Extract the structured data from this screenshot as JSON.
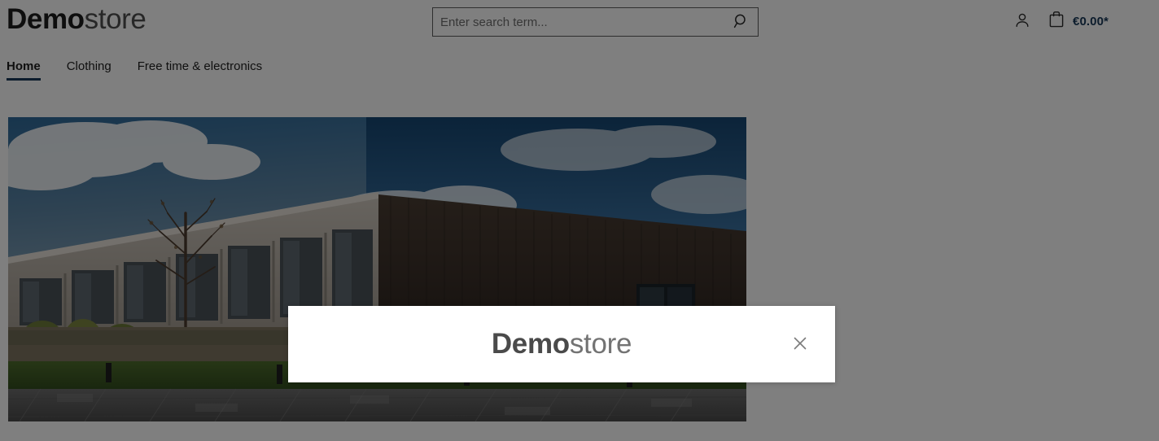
{
  "header": {
    "logo": {
      "bold": "Demo",
      "light": "store"
    },
    "search": {
      "placeholder": "Enter search term...",
      "value": "",
      "icon": "search-icon"
    },
    "account": {
      "icon": "person-icon",
      "label": ""
    },
    "cart": {
      "icon": "shopping-bag-icon",
      "amount": "€0.00*"
    }
  },
  "nav": {
    "items": [
      {
        "label": "Home",
        "active": true
      },
      {
        "label": "Clothing",
        "active": false
      },
      {
        "label": "Free time & electronics",
        "active": false
      }
    ]
  },
  "hero": {
    "alt": "Modern dark-wood and concrete office building under blue sky with clouds"
  },
  "modal": {
    "logo": {
      "bold": "Demo",
      "light": "store"
    },
    "close_icon": "close-icon",
    "close_label": "×"
  },
  "colors": {
    "accent": "#183959",
    "logo_bold": "#1d1d1d",
    "logo_light": "#4f4f4f",
    "modal_logo_bold": "#4a4a4a",
    "modal_logo_light": "#737373",
    "overlay": "rgba(0,0,0,0.5)",
    "page_background": "#ffffff"
  }
}
